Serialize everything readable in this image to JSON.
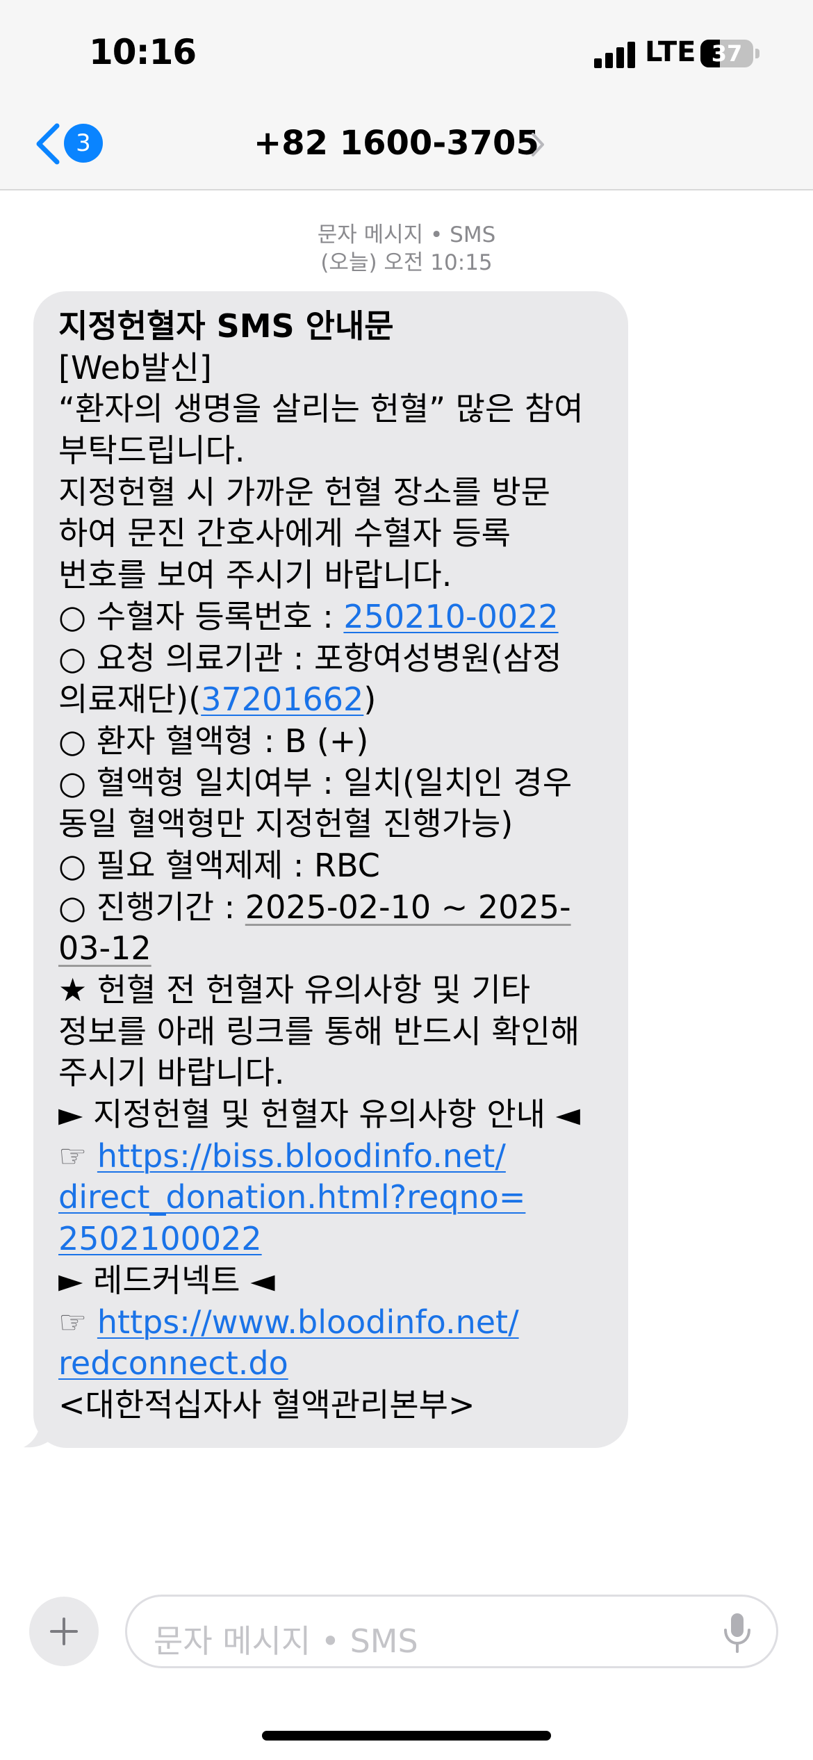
{
  "status_bar": {
    "time": "10:16",
    "network": "LTE",
    "battery_level": "37"
  },
  "nav": {
    "back_badge": "3",
    "title": "+82 1600-3705"
  },
  "thread": {
    "service": "문자 메시지 • SMS",
    "timestamp": "(오늘) 오전 10:15"
  },
  "message": {
    "title": "지정헌혈자 SMS 안내문",
    "l01": "[Web발신]",
    "l02": "“환자의 생명을 살리는 헌혈” 많은 참여",
    "l03": "부탁드립니다.",
    "l04": "지정헌혈 시 가까운 헌혈 장소를 방문",
    "l05": "하여 문진 간호사에게 수혈자 등록",
    "l06": "번호를 보여 주시기 바랍니다.",
    "l07_label": "○ 수혈자 등록번호 : ",
    "l07_link": "250210-0022",
    "l08": "○ 요청 의료기관 : 포항여성병원(삼정",
    "l09_pre": "의료재단)(",
    "l09_link": "37201662",
    "l09_post": ")",
    "l10": "○ 환자 혈액형 : B (+)",
    "l11": "○ 혈액형 일치여부 : 일치(일치인 경우",
    "l12": "동일 혈액형만 지정헌혈 진행가능)",
    "l13": "○ 필요 혈액제제 : RBC",
    "l14_label": "○ 진행기간 : ",
    "l14_date": "2025-02-10 ~ 2025-",
    "l15_date": "03-12",
    "l16": "★ 헌혈 전 헌혈자 유의사항 및 기타",
    "l17": "정보를 아래 링크를 통해 반드시 확인해",
    "l18": "주시기 바랍니다.",
    "l19": "► 지정헌혈 및 헌혈자 유의사항 안내 ◄",
    "l20_pointer": "☞ ",
    "l20_link": "https://biss.bloodinfo.net/",
    "l21_link": "direct_donation.html?reqno=",
    "l22_link": "2502100022",
    "l23": "► 레드커넥트 ◄",
    "l24_pointer": "☞ ",
    "l24_link": "https://www.bloodinfo.net/",
    "l25_link": "redconnect.do",
    "l26": "<대한적십자사 혈액관리본부>"
  },
  "composer": {
    "placeholder": "문자 메시지 • SMS"
  },
  "icons": {
    "back": "chevron-left-icon",
    "contact_details": "chevron-right-icon",
    "add": "plus-icon",
    "dictation": "microphone-icon"
  },
  "colors": {
    "accent_blue": "#0a84ff",
    "link_blue": "#1a73e8",
    "bubble_gray": "#e9e9eb"
  }
}
